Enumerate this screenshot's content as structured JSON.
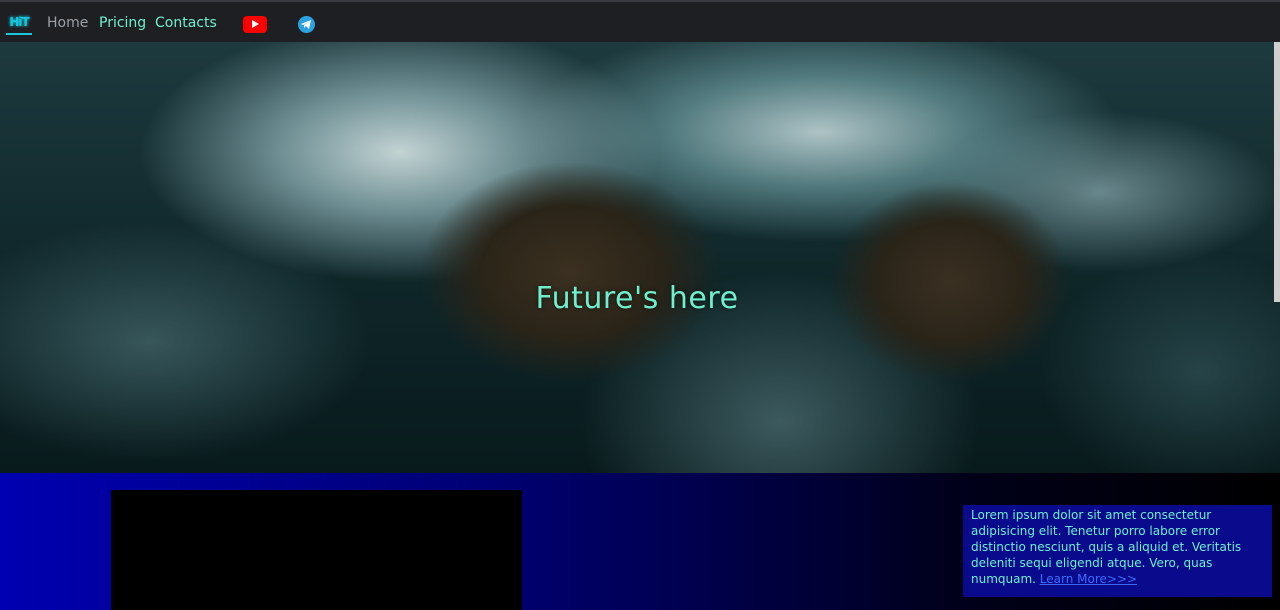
{
  "nav": {
    "logo": "HiT",
    "home": "Home",
    "pricing": "Pricing",
    "contacts": "Contacts",
    "youtube_icon": "youtube-icon",
    "telegram_icon": "telegram-icon"
  },
  "hero": {
    "title": "Future's here"
  },
  "card": {
    "text": "Lorem ipsum dolor sit amet consectetur adipisicing elit. Tenetur porro labore error distinctio nesciunt, quis a aliquid et. Veritatis deleniti sequi eligendi atque. Vero, quas numquam.",
    "link": "Learn More>>>"
  },
  "colors": {
    "accent": "#6ef0cf",
    "nav_bg": "#1e1f23",
    "link": "#3b6bff",
    "youtube": "#ff0000",
    "telegram": "#2aa3e0"
  }
}
